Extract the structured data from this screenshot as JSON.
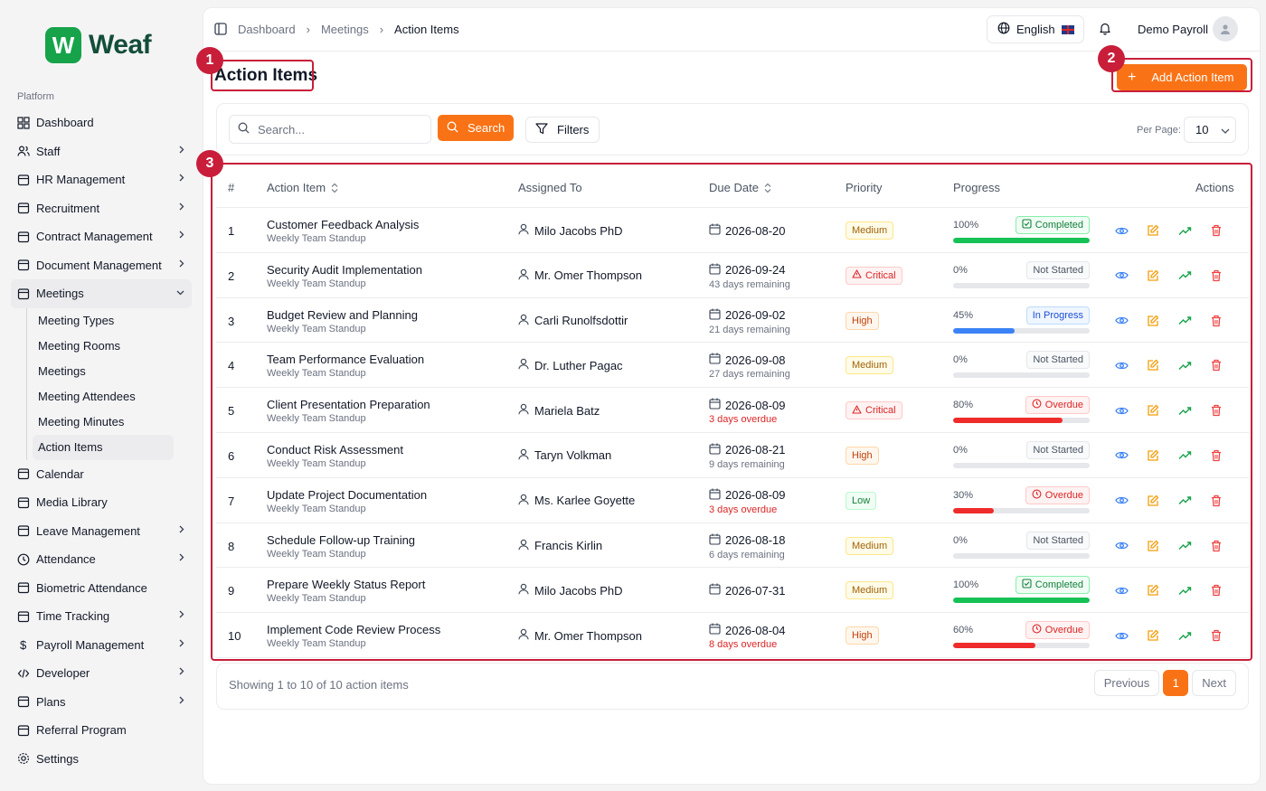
{
  "brand": {
    "letter": "W",
    "name": "Weaf",
    "color": "#16a34a"
  },
  "sidebar": {
    "section_label": "Platform",
    "items": [
      {
        "label": "Dashboard",
        "icon": "grid-icon",
        "chev": false
      },
      {
        "label": "Staff",
        "icon": "users-icon",
        "chev": true
      },
      {
        "label": "HR Management",
        "icon": "briefcase-icon",
        "chev": true
      },
      {
        "label": "Recruitment",
        "icon": "user-plus-icon",
        "chev": true
      },
      {
        "label": "Contract Management",
        "icon": "file-text-icon",
        "chev": true
      },
      {
        "label": "Document Management",
        "icon": "folder-icon",
        "chev": true
      },
      {
        "label": "Meetings",
        "icon": "calendar-icon",
        "chev": true
      }
    ],
    "meetings_sub": [
      "Meeting Types",
      "Meeting Rooms",
      "Meetings",
      "Meeting Attendees",
      "Meeting Minutes",
      "Action Items"
    ],
    "items_after": [
      {
        "label": "Calendar",
        "icon": "calendar-icon",
        "chev": false
      },
      {
        "label": "Media Library",
        "icon": "image-icon",
        "chev": false
      },
      {
        "label": "Leave Management",
        "icon": "calendar-icon",
        "chev": true
      },
      {
        "label": "Attendance",
        "icon": "clock-icon",
        "chev": true
      },
      {
        "label": "Biometric Attendance",
        "icon": "fingerprint-icon",
        "chev": false
      },
      {
        "label": "Time Tracking",
        "icon": "timer-icon",
        "chev": true
      },
      {
        "label": "Payroll Management",
        "icon": "dollar-icon",
        "chev": true
      },
      {
        "label": "Developer",
        "icon": "code-icon",
        "chev": true
      },
      {
        "label": "Plans",
        "icon": "card-icon",
        "chev": true
      },
      {
        "label": "Referral Program",
        "icon": "gift-icon",
        "chev": false
      },
      {
        "label": "Settings",
        "icon": "gear-icon",
        "chev": false
      }
    ]
  },
  "header": {
    "breadcrumbs": [
      "Dashboard",
      "Meetings",
      "Action Items"
    ],
    "language": "English",
    "user": "Demo Payroll"
  },
  "page": {
    "title": "Action Items",
    "add_label": "Add Action Item"
  },
  "toolbar": {
    "search_placeholder": "Search...",
    "search_label": "Search",
    "filters_label": "Filters",
    "per_page_label": "Per Page:",
    "per_page_value": "10"
  },
  "table": {
    "headers": {
      "num": "#",
      "item": "Action Item",
      "assigned": "Assigned To",
      "due": "Due Date",
      "priority": "Priority",
      "progress": "Progress",
      "actions": "Actions"
    },
    "rows": [
      {
        "num": "1",
        "title": "Customer Feedback Analysis",
        "sub": "Weekly Team Standup",
        "assigned": "Milo Jacobs PhD",
        "due": "2026-08-20",
        "remain": "",
        "over": false,
        "priority": "Medium",
        "pclass": "medium",
        "pct": "100%",
        "progress": 100,
        "status": "Completed",
        "sclass": "completed",
        "color": "#16c155"
      },
      {
        "num": "2",
        "title": "Security Audit Implementation",
        "sub": "Weekly Team Standup",
        "assigned": "Mr. Omer Thompson",
        "due": "2026-09-24",
        "remain": "43 days remaining",
        "over": false,
        "priority": "Critical",
        "pclass": "critical",
        "pct": "0%",
        "progress": 0,
        "status": "Not Started",
        "sclass": "notstarted",
        "color": "#e5e7eb"
      },
      {
        "num": "3",
        "title": "Budget Review and Planning",
        "sub": "Weekly Team Standup",
        "assigned": "Carli Runolfsdottir",
        "due": "2026-09-02",
        "remain": "21 days remaining",
        "over": false,
        "priority": "High",
        "pclass": "high",
        "pct": "45%",
        "progress": 45,
        "status": "In Progress",
        "sclass": "inprogress",
        "color": "#3b82f6"
      },
      {
        "num": "4",
        "title": "Team Performance Evaluation",
        "sub": "Weekly Team Standup",
        "assigned": "Dr. Luther Pagac",
        "due": "2026-09-08",
        "remain": "27 days remaining",
        "over": false,
        "priority": "Medium",
        "pclass": "medium",
        "pct": "0%",
        "progress": 0,
        "status": "Not Started",
        "sclass": "notstarted",
        "color": "#e5e7eb"
      },
      {
        "num": "5",
        "title": "Client Presentation Preparation",
        "sub": "Weekly Team Standup",
        "assigned": "Mariela Batz",
        "due": "2026-08-09",
        "remain": "3 days overdue",
        "over": true,
        "priority": "Critical",
        "pclass": "critical",
        "pct": "80%",
        "progress": 80,
        "status": "Overdue",
        "sclass": "overdue",
        "color": "#ef2b2b"
      },
      {
        "num": "6",
        "title": "Conduct Risk Assessment",
        "sub": "Weekly Team Standup",
        "assigned": "Taryn Volkman",
        "due": "2026-08-21",
        "remain": "9 days remaining",
        "over": false,
        "priority": "High",
        "pclass": "high",
        "pct": "0%",
        "progress": 0,
        "status": "Not Started",
        "sclass": "notstarted",
        "color": "#e5e7eb"
      },
      {
        "num": "7",
        "title": "Update Project Documentation",
        "sub": "Weekly Team Standup",
        "assigned": "Ms. Karlee Goyette",
        "due": "2026-08-09",
        "remain": "3 days overdue",
        "over": true,
        "priority": "Low",
        "pclass": "low",
        "pct": "30%",
        "progress": 30,
        "status": "Overdue",
        "sclass": "overdue",
        "color": "#ef2b2b"
      },
      {
        "num": "8",
        "title": "Schedule Follow-up Training",
        "sub": "Weekly Team Standup",
        "assigned": "Francis Kirlin",
        "due": "2026-08-18",
        "remain": "6 days remaining",
        "over": false,
        "priority": "Medium",
        "pclass": "medium",
        "pct": "0%",
        "progress": 0,
        "status": "Not Started",
        "sclass": "notstarted",
        "color": "#e5e7eb"
      },
      {
        "num": "9",
        "title": "Prepare Weekly Status Report",
        "sub": "Weekly Team Standup",
        "assigned": "Milo Jacobs PhD",
        "due": "2026-07-31",
        "remain": "",
        "over": false,
        "priority": "Medium",
        "pclass": "medium",
        "pct": "100%",
        "progress": 100,
        "status": "Completed",
        "sclass": "completed",
        "color": "#16c155"
      },
      {
        "num": "10",
        "title": "Implement Code Review Process",
        "sub": "Weekly Team Standup",
        "assigned": "Mr. Omer Thompson",
        "due": "2026-08-04",
        "remain": "8 days overdue",
        "over": true,
        "priority": "High",
        "pclass": "high",
        "pct": "60%",
        "progress": 60,
        "status": "Overdue",
        "sclass": "overdue",
        "color": "#ef2b2b"
      }
    ]
  },
  "footer": {
    "showing": "Showing 1 to 10 of 10 action items",
    "prev": "Previous",
    "page": "1",
    "next": "Next"
  },
  "annotations": [
    "1",
    "2",
    "3"
  ],
  "accent": "#f97316",
  "annotation_color": "#c81e3a"
}
